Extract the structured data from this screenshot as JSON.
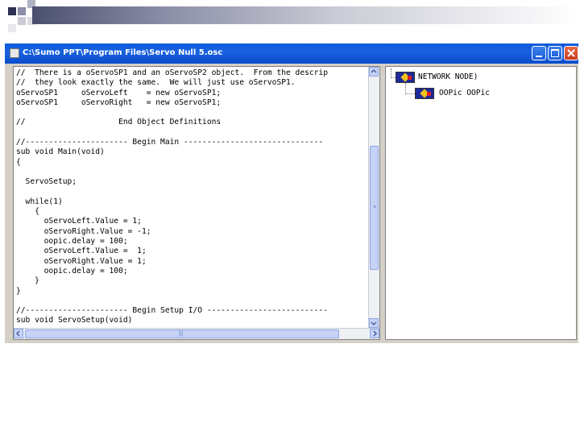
{
  "window": {
    "title": "C:\\Sumo PPT\\Program Files\\Servo Null 5.osc"
  },
  "editor": {
    "lines": [
      "//  There is a oServoSP1 and an oServoSP2 object.  From the descrip",
      "//  they look exactly the same.  We will just use oServoSP1.",
      "oServoSP1     oServoLeft    = new oServoSP1;",
      "oServoSP1     oServoRight   = new oServoSP1;",
      "",
      "//                    End Object Definitions",
      "",
      "//---------------------- Begin Main ------------------------------",
      "sub void Main(void)",
      "{",
      "",
      "  ServoSetup;",
      "",
      "  while(1)",
      "    {",
      "      oServoLeft.Value = 1;",
      "      oServoRight.Value = -1;",
      "      oopic.delay = 100;",
      "      oServoLeft.Value =  1;",
      "      oServoRight.Value = 1;",
      "      oopic.delay = 100;",
      "    }",
      "}",
      "",
      "//---------------------- Begin Setup I/O --------------------------",
      "sub void ServoSetup(void)"
    ],
    "scroll_up_icon": "arrow-up-icon",
    "scroll_down_icon": "arrow-down-icon",
    "scroll_left_icon": "arrow-left-icon",
    "scroll_right_icon": "arrow-right-icon"
  },
  "tree": {
    "root_label": "NETWORK NODE)",
    "child_label": "OOPic OOPic"
  },
  "colors": {
    "titlebar": "#0a4ccc",
    "close_button": "#c63a1c",
    "scroll_thumb": "#c6d3f7"
  }
}
